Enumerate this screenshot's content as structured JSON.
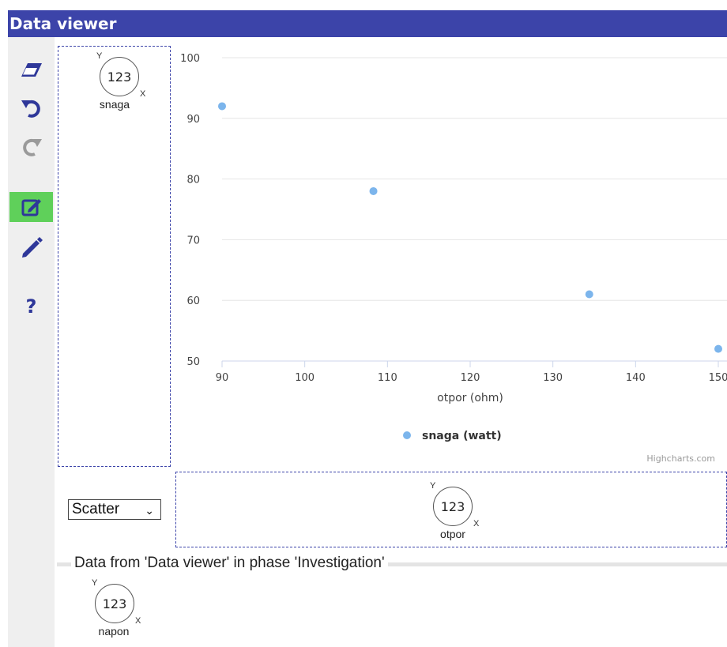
{
  "window": {
    "title": "Data viewer"
  },
  "toolbar": {
    "items": [
      {
        "icon": "eraser-icon"
      },
      {
        "icon": "undo-icon"
      },
      {
        "icon": "redo-icon"
      },
      {
        "icon": "edit-box-icon"
      },
      {
        "icon": "pencil-icon"
      },
      {
        "icon": "help-icon",
        "label": "?"
      }
    ],
    "active_color": "#5fd05a"
  },
  "y_attribute": {
    "value": "123",
    "y": "Y",
    "x": "X",
    "name": "snaga"
  },
  "x_attribute": {
    "value": "123",
    "y": "Y",
    "x": "X",
    "name": "otpor"
  },
  "chart_type_select": {
    "selected": "Scatter"
  },
  "data_section": {
    "title": "Data from 'Data viewer' in phase 'Investigation'",
    "attribute": {
      "value": "123",
      "y": "Y",
      "x": "X",
      "name": "napon"
    }
  },
  "credits": "Highcharts.com",
  "chart_data": {
    "type": "scatter",
    "xlabel": "otpor (ohm)",
    "ylabel": "",
    "xlim": [
      90,
      150
    ],
    "ylim": [
      50,
      100
    ],
    "x_ticks": [
      "90",
      "100",
      "110",
      "120",
      "130",
      "140",
      "150"
    ],
    "y_ticks": [
      "50",
      "60",
      "70",
      "80",
      "90",
      "100"
    ],
    "grid": true,
    "legend_position": "bottom",
    "series": [
      {
        "name": "snaga (watt)",
        "color": "#7cb5ec",
        "points": [
          [
            90,
            92
          ],
          [
            108.3,
            78
          ],
          [
            134.4,
            61
          ],
          [
            150,
            52
          ]
        ]
      }
    ]
  }
}
